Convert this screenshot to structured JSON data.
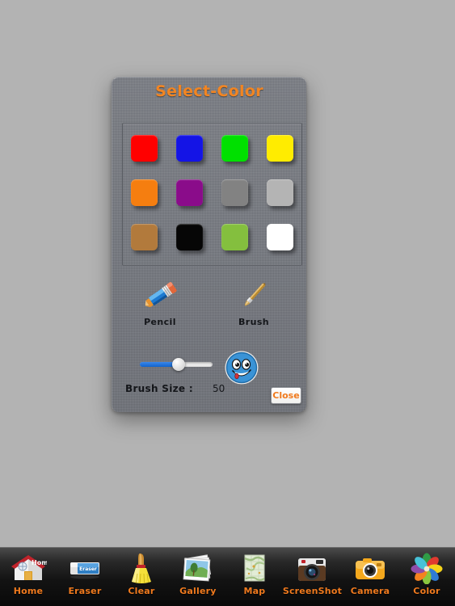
{
  "app": {
    "background_color": "#b3b3b3"
  },
  "dialog": {
    "title": "Select-Color",
    "title_color": "#f28522",
    "panel_color": "#73767d",
    "colors": [
      {
        "name": "red",
        "hex": "#ff0000"
      },
      {
        "name": "blue",
        "hex": "#1414e6"
      },
      {
        "name": "green",
        "hex": "#00e000"
      },
      {
        "name": "yellow",
        "hex": "#ffec00"
      },
      {
        "name": "orange",
        "hex": "#f57e10"
      },
      {
        "name": "purple",
        "hex": "#8a0c8a"
      },
      {
        "name": "dark-gray",
        "hex": "#828282"
      },
      {
        "name": "light-gray",
        "hex": "#b4b4b4"
      },
      {
        "name": "brown",
        "hex": "#b27a3c"
      },
      {
        "name": "black",
        "hex": "#060606"
      },
      {
        "name": "olive-green",
        "hex": "#84bf3e"
      },
      {
        "name": "white",
        "hex": "#ffffff"
      }
    ],
    "tools": [
      {
        "id": "pencil",
        "label": "Pencil",
        "icon": "pencil-icon"
      },
      {
        "id": "brush",
        "label": "Brush",
        "icon": "brush-icon"
      }
    ],
    "brush_size": {
      "label": "Brush Size :",
      "value": "50",
      "min": "0",
      "max": "100",
      "fill_color": "#1064cf"
    },
    "smiley": {
      "name": "smiley-face-button",
      "color": "#3a93d6"
    },
    "close_button": {
      "label": "Close",
      "color": "#f07a1e"
    }
  },
  "toolbar": {
    "items": [
      {
        "id": "home",
        "label": "Home",
        "icon": "home-icon"
      },
      {
        "id": "eraser",
        "label": "Eraser",
        "icon": "eraser-icon"
      },
      {
        "id": "clear",
        "label": "Clear",
        "icon": "broom-icon"
      },
      {
        "id": "gallery",
        "label": "Gallery",
        "icon": "photos-icon"
      },
      {
        "id": "map",
        "label": "Map",
        "icon": "map-icon"
      },
      {
        "id": "screenshot",
        "label": "ScreenShot",
        "icon": "camera-retro-icon"
      },
      {
        "id": "camera",
        "label": "Camera",
        "icon": "camera-icon"
      },
      {
        "id": "color",
        "label": "Color",
        "icon": "color-pinwheel-icon"
      }
    ],
    "label_color": "#f07a1e"
  }
}
